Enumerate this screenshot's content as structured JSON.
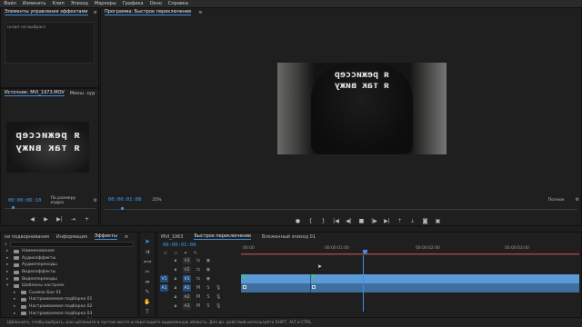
{
  "menu": [
    "Файл",
    "Изменить",
    "Клип",
    "Эпизод",
    "Маркеры",
    "Графика",
    "Окно",
    "Справка"
  ],
  "effect_controls": {
    "title": "Элементы управления эффектами",
    "no_clip": "(клип не выбран)"
  },
  "source": {
    "tab_label": "Источник: MVI_1973.MOV",
    "mix_tab": "Микш. зуд",
    "timecode": "00:00:06:10",
    "fit_label": "По размеру кадра",
    "preview_text_line1": "я режиссер",
    "preview_text_line2": "я так вижу"
  },
  "program": {
    "title": "Программа: Быстрое переключение",
    "timecode": "00:00:01:08",
    "zoom": "25%",
    "quality": "Полное",
    "preview_text_line1": "я режиссер",
    "preview_text_line2": "я так вижу"
  },
  "project": {
    "tabs": [
      "ки подворнивания",
      "Информация",
      "Эффекты"
    ],
    "items": [
      {
        "label": "Наименования",
        "indent": 1,
        "expanded": false
      },
      {
        "label": "Аудиоэффекты",
        "indent": 1,
        "expanded": false
      },
      {
        "label": "Аудиопереходы",
        "indent": 1,
        "expanded": false
      },
      {
        "label": "Видеоэффекты",
        "indent": 1,
        "expanded": false
      },
      {
        "label": "Видеопереходы",
        "indent": 1,
        "expanded": false
      },
      {
        "label": "Шаблоны настроек",
        "indent": 1,
        "expanded": true
      },
      {
        "label": "Сьемок Бок 01",
        "indent": 2,
        "expanded": false
      },
      {
        "label": "Настраиваемая подборка 01",
        "indent": 2,
        "expanded": false
      },
      {
        "label": "Настраиваемая подборка 02",
        "indent": 2,
        "expanded": false
      },
      {
        "label": "Настраиваемая подборка 03",
        "indent": 2,
        "expanded": false
      },
      {
        "label": "Настраиваемая подборка 04",
        "indent": 2,
        "expanded": false
      }
    ]
  },
  "timeline": {
    "tabs": [
      "MVI_1963",
      "Быстрое переключение",
      "Вложенный эпизод 01"
    ],
    "active_tab": 1,
    "timecode": "00:00:01:08",
    "ruler_labels": [
      "00:00",
      "00:00:01:00",
      "00:00:02:00",
      "00:00:03:00"
    ],
    "video_tracks": [
      "V3",
      "V2",
      "V1"
    ],
    "audio_tracks": [
      "A1",
      "A2",
      "A3"
    ],
    "source_patch_v": "V1",
    "source_patch_a": "A1"
  },
  "status_bar": "Щёлкните, чтобы выбрать, или щёлкните в пустом месте и перетащите выделенную область. Для до. действий используйте SHIFT, ALT и CTRL.",
  "colors": {
    "accent": "#3f9cf0",
    "clip_video": "#5b9ad6",
    "clip_audio": "#3e6f9e",
    "playhead": "#3f8ee6",
    "work_area": "#c23a3a"
  }
}
